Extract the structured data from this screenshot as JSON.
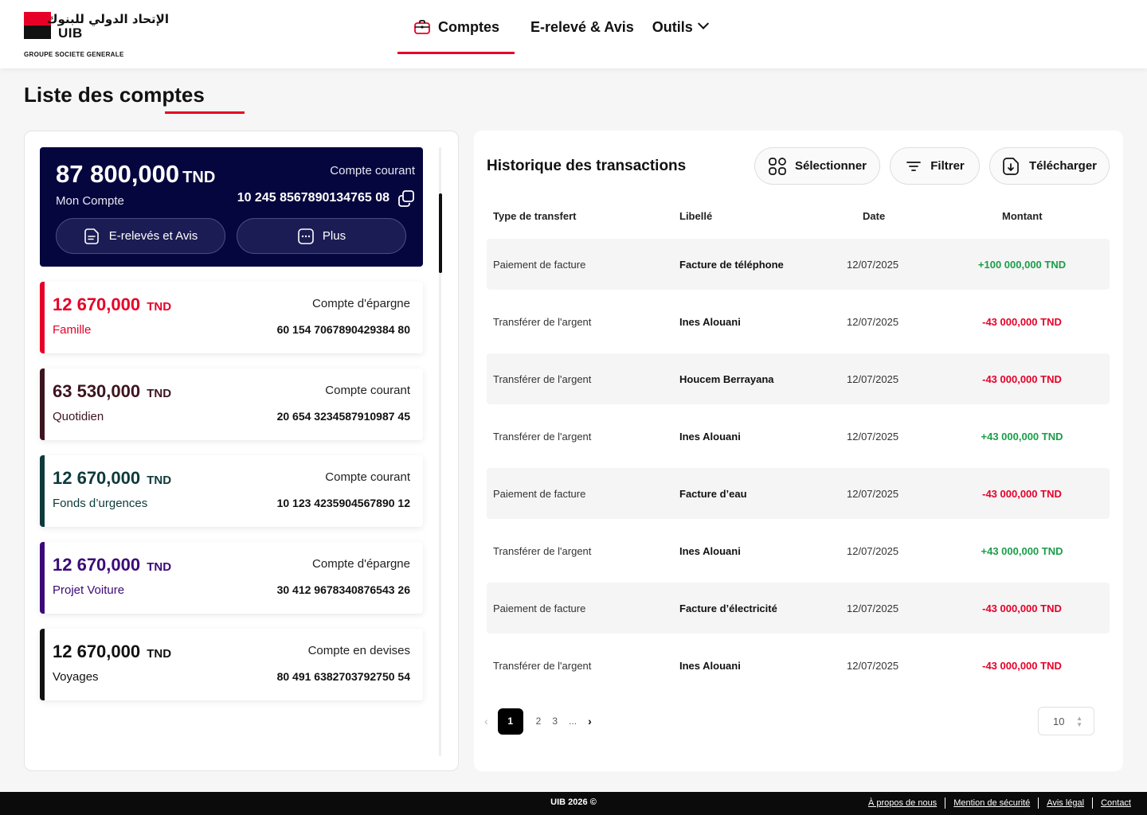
{
  "brand": {
    "arabic_name": "الإتحاد الدولي للبنوك",
    "short_name": "UIB",
    "group": "GROUPE SOCIETE GENERALE",
    "accent_color": "#e60028"
  },
  "nav": {
    "items": [
      {
        "label": "Comptes",
        "icon": "briefcase-icon",
        "active": true
      },
      {
        "label": "E-relevé & Avis"
      },
      {
        "label": "Outils",
        "icon": "chevron-down-icon"
      }
    ]
  },
  "page": {
    "title": "Liste des comptes"
  },
  "main_account": {
    "amount": "87 800,000",
    "currency": "TND",
    "name": "Mon Compte",
    "type": "Compte courant",
    "number": "10 245 8567890134765 08",
    "buttons": [
      {
        "label": "E-relevés et Avis",
        "icon": "document-icon"
      },
      {
        "label": "Plus",
        "icon": "more-icon"
      }
    ],
    "background_color": "#06063f"
  },
  "accounts": [
    {
      "amount": "12 670,000",
      "currency": "TND",
      "name": "Famille",
      "type": "Compte d'épargne",
      "number": "60 154 7067890429384 80",
      "color": "#e60028"
    },
    {
      "amount": "63 530,000",
      "currency": "TND",
      "name": "Quotidien",
      "type": "Compte courant",
      "number": "20 654 3234587910987 45",
      "color": "#3d1420"
    },
    {
      "amount": "12 670,000",
      "currency": "TND",
      "name": "Fonds d’urgences",
      "type": "Compte courant",
      "number": "10 123 4235904567890 12",
      "color": "#0d3a3a"
    },
    {
      "amount": "12 670,000",
      "currency": "TND",
      "name": "Projet Voiture",
      "type": "Compte d'épargne",
      "number": "30 412 9678340876543 26",
      "color": "#3b0a78"
    },
    {
      "amount": "12 670,000",
      "currency": "TND",
      "name": "Voyages",
      "type": "Compte en devises",
      "number": "80 491 6382703792750 54",
      "color": "#111111"
    }
  ],
  "transactions": {
    "title": "Historique des transactions",
    "actions": [
      {
        "label": "Sélectionner",
        "icon": "grid-icon"
      },
      {
        "label": "Filtrer",
        "icon": "filter-icon"
      },
      {
        "label": "Télécharger",
        "icon": "download-icon"
      }
    ],
    "columns": [
      "Type de transfert",
      "Libellé",
      "Date",
      "Montant"
    ],
    "rows": [
      {
        "type": "Paiement de facture",
        "label": "Facture de téléphone",
        "date": "12/07/2025",
        "amount": "+100 000,000 TND",
        "direction": "credit"
      },
      {
        "type": "Transférer de l'argent",
        "label": "Ines Alouani",
        "date": "12/07/2025",
        "amount": "-43 000,000 TND",
        "direction": "debit"
      },
      {
        "type": "Transférer de l'argent",
        "label": "Houcem Berrayana",
        "date": "12/07/2025",
        "amount": "-43 000,000 TND",
        "direction": "debit"
      },
      {
        "type": "Transférer de l'argent",
        "label": "Ines Alouani",
        "date": "12/07/2025",
        "amount": "+43 000,000 TND",
        "direction": "credit"
      },
      {
        "type": "Paiement de facture",
        "label": "Facture d’eau",
        "date": "12/07/2025",
        "amount": "-43 000,000 TND",
        "direction": "debit"
      },
      {
        "type": "Transférer de l'argent",
        "label": "Ines Alouani",
        "date": "12/07/2025",
        "amount": "+43 000,000 TND",
        "direction": "credit"
      },
      {
        "type": "Paiement de facture",
        "label": "Facture d’électricité",
        "date": "12/07/2025",
        "amount": "-43 000,000 TND",
        "direction": "debit"
      },
      {
        "type": "Transférer de l'argent",
        "label": "Ines Alouani",
        "date": "12/07/2025",
        "amount": "-43 000,000 TND",
        "direction": "debit"
      }
    ],
    "pagination": {
      "current": "1",
      "pages": [
        "2",
        "3",
        "..."
      ],
      "per_page": "10"
    }
  },
  "footer": {
    "copyright": "UIB 2026 ©",
    "links": [
      "À propos de nous",
      "Mention de sécurité",
      "Avis légal",
      "Contact"
    ]
  }
}
